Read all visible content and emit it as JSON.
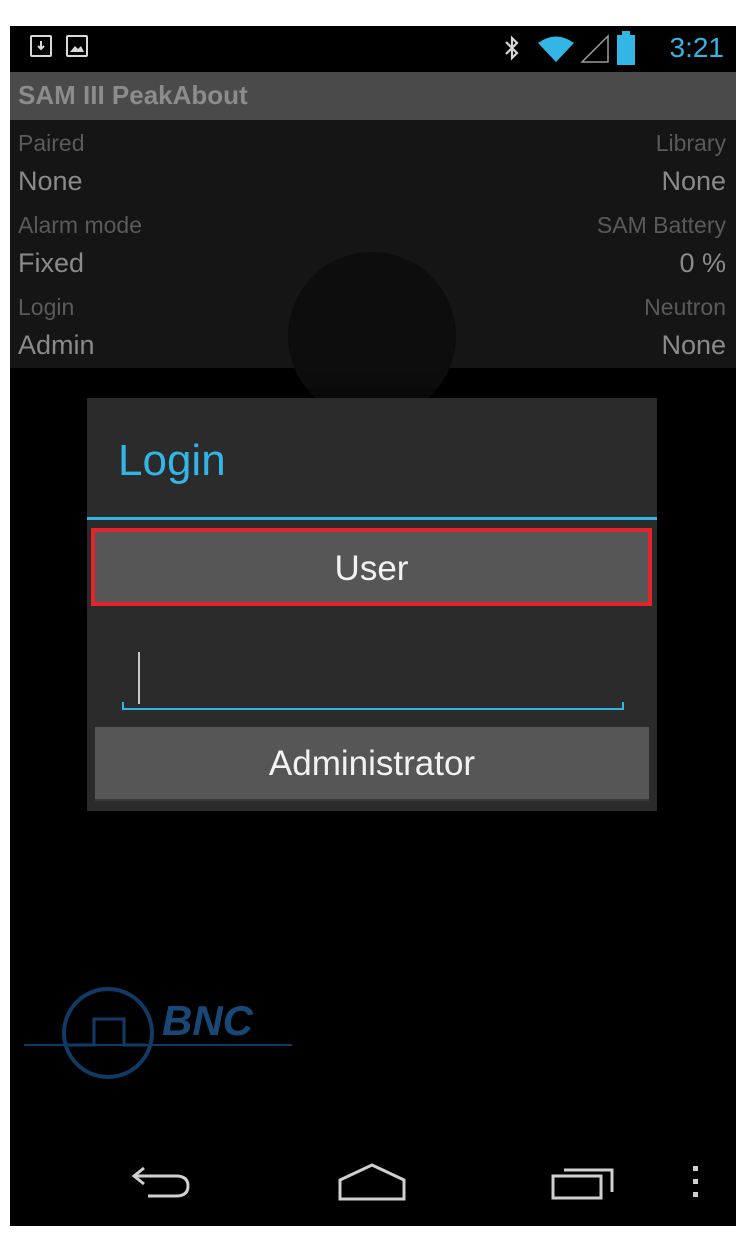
{
  "status_bar": {
    "time": "3:21",
    "icons": [
      "download-icon",
      "image-icon",
      "bluetooth-icon",
      "wifi-icon",
      "signal-icon",
      "battery-icon"
    ]
  },
  "app": {
    "title": "SAM III PeakAbout"
  },
  "info": {
    "paired_label": "Paired",
    "paired_value": "None",
    "library_label": "Library",
    "library_value": "None",
    "alarm_label": "Alarm mode",
    "alarm_value": "Fixed",
    "battery_label": "SAM Battery",
    "battery_value": "0 %",
    "login_label": "Login",
    "login_value": "Admin",
    "neutron_label": "Neutron",
    "neutron_value": "None"
  },
  "dialog": {
    "title": "Login",
    "user_button": "User",
    "password_value": "",
    "admin_button": "Administrator"
  },
  "logo": {
    "text": "BNC"
  },
  "colors": {
    "accent": "#33b5e5",
    "highlight": "#e3242b",
    "dialog_bg": "#2b2b2b",
    "button_bg": "#565656"
  },
  "nav": {
    "icons": [
      "back-icon",
      "home-icon",
      "recent-apps-icon",
      "overflow-menu-icon"
    ]
  }
}
